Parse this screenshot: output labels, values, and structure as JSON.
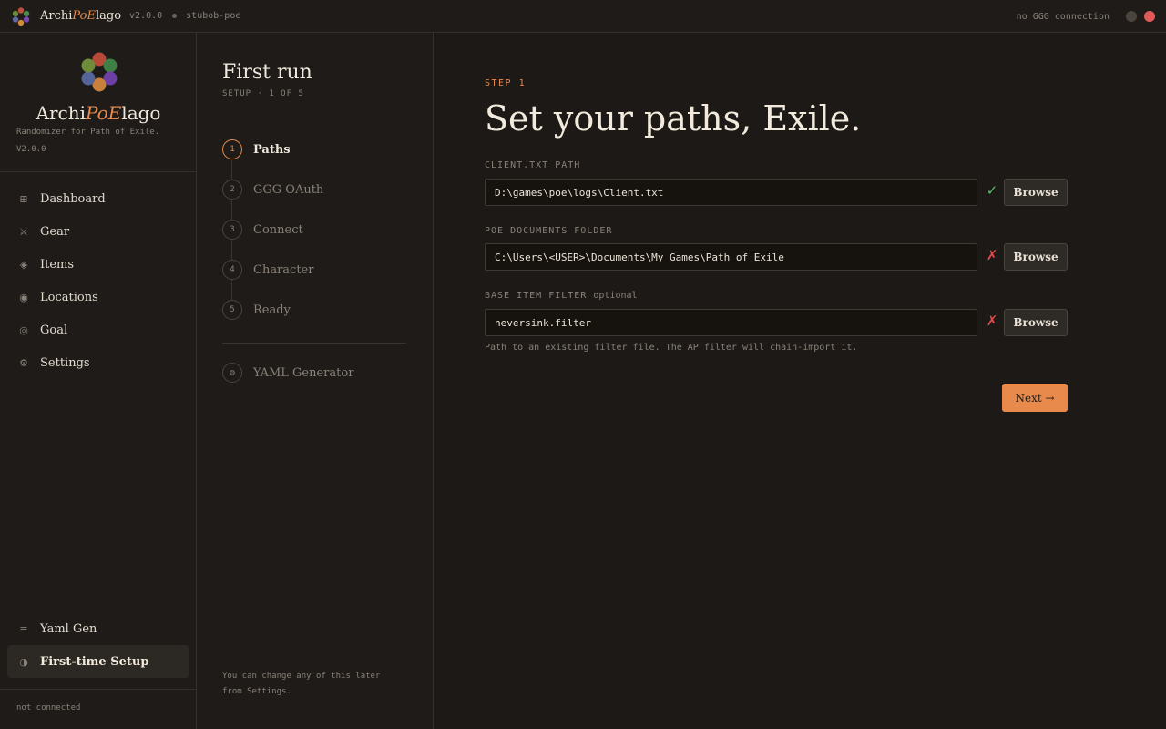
{
  "titlebar": {
    "app_name_start": "Archi",
    "app_name_accent": "PoE",
    "app_name_end": "lago",
    "version": "v2.0.0",
    "league": "stubob-poe",
    "connection_status": "no GGG connection"
  },
  "sidebar": {
    "brand": {
      "name_start": "Archi",
      "name_accent": "PoE",
      "name_end": "lago",
      "tagline": "Randomizer for Path of Exile.",
      "version": "V2.0.0"
    },
    "items": [
      {
        "label": "Dashboard",
        "icon": "dashboard-icon",
        "glyph": "⊞"
      },
      {
        "label": "Gear",
        "icon": "swords-icon",
        "glyph": "⚔"
      },
      {
        "label": "Items",
        "icon": "item-icon",
        "glyph": "◈"
      },
      {
        "label": "Locations",
        "icon": "location-icon",
        "glyph": "◉"
      },
      {
        "label": "Goal",
        "icon": "goal-icon",
        "glyph": "◎"
      },
      {
        "label": "Settings",
        "icon": "gear-icon",
        "glyph": "⚙"
      }
    ],
    "bottom_items": [
      {
        "label": "Yaml Gen",
        "icon": "list-icon",
        "glyph": "≡"
      },
      {
        "label": "First-time Setup",
        "icon": "contrast-icon",
        "glyph": "◑"
      }
    ],
    "footer_status": "not connected"
  },
  "steps_panel": {
    "title": "First run",
    "subtitle": "SETUP · 1 OF 5",
    "steps": [
      {
        "number": "1",
        "label": "Paths"
      },
      {
        "number": "2",
        "label": "GGG OAuth"
      },
      {
        "number": "3",
        "label": "Connect"
      },
      {
        "number": "4",
        "label": "Character"
      },
      {
        "number": "5",
        "label": "Ready"
      }
    ],
    "extra": {
      "label": "YAML Generator",
      "glyph": "⚙"
    },
    "note": "You can change any of this later from Settings."
  },
  "main": {
    "step_label": "STEP 1",
    "headline": "Set your paths, Exile.",
    "fields": [
      {
        "label": "CLIENT.TXT PATH",
        "optional": "",
        "value": "D:\\games\\poe\\logs\\Client.txt",
        "status": "✓",
        "browse": "Browse"
      },
      {
        "label": "POE DOCUMENTS FOLDER",
        "optional": "",
        "value": "C:\\Users\\<USER>\\Documents\\My Games\\Path of Exile",
        "status": "✗",
        "browse": "Browse"
      },
      {
        "label": "BASE ITEM FILTER",
        "optional": "optional",
        "value": "neversink.filter",
        "status": "✗",
        "browse": "Browse"
      }
    ],
    "hint": "Path to an existing filter file. The AP filter will chain-import it.",
    "next_label": "Next →"
  },
  "colors": {
    "accent": "#e88a4c",
    "ok": "#58c06a",
    "error": "#e04a4a",
    "background": "#1c1917"
  }
}
